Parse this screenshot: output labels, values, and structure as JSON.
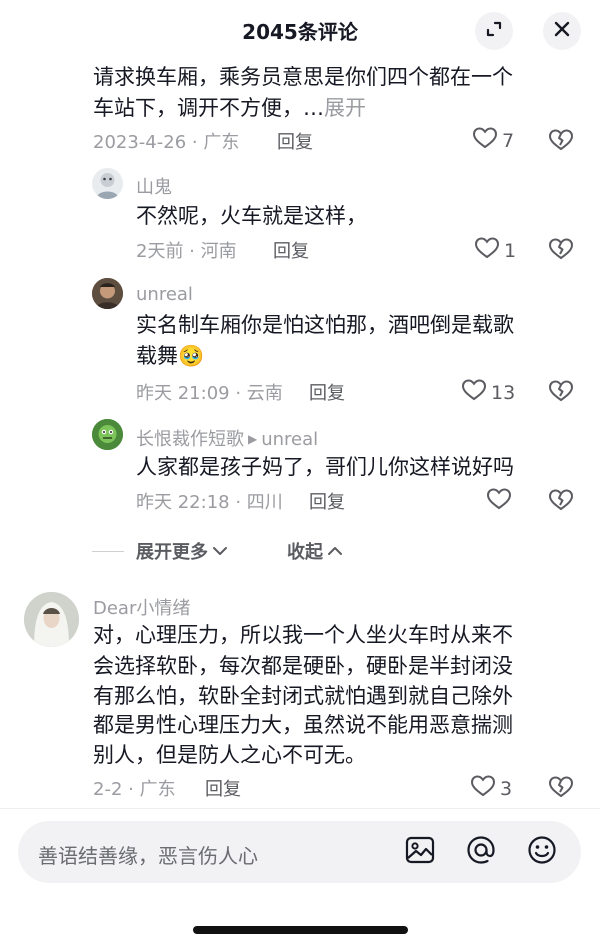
{
  "header": {
    "title": "2045条评论"
  },
  "icons": {
    "expand": "expand-icon",
    "close": "close-icon",
    "heart": "heart-icon",
    "dislike": "broken-heart-icon",
    "image": "image-icon",
    "at": "at-icon",
    "emoji": "emoji-icon"
  },
  "colors": {
    "text": "#161823",
    "muted": "#9b9ca1",
    "reply": "#5b5c61"
  },
  "comments": {
    "top": {
      "line1": "请求换车厢，乘务员意思是你们四个都在一个",
      "line2": "车站下，调开不方便，…",
      "expand_label": "展开",
      "meta": "2023-4-26 · 广东",
      "reply": "回复",
      "likes": "7"
    },
    "r1": {
      "name": "山鬼",
      "text": "不然呢，火车就是这样，",
      "meta": "2天前 · 河南",
      "reply": "回复",
      "likes": "1"
    },
    "r2": {
      "name": "unreal",
      "line1": "实名制车厢你是怕这怕那，酒吧倒是载歌",
      "line2": "载舞",
      "emoji": "🥹",
      "meta": "昨天 21:09 · 云南",
      "reply": "回复",
      "likes": "13"
    },
    "r3": {
      "name": "长恨裁作短歌",
      "reply_to": "unreal",
      "text": "人家都是孩子妈了，哥们儿你这样说好吗",
      "meta": "昨天 22:18 · 四川",
      "reply": "回复"
    },
    "expand_more": "展开更多",
    "collapse": "收起",
    "c2": {
      "name": "Dear小情绪",
      "lines": [
        "对，心理压力，所以我一个人坐火车时从来不",
        "会选择软卧，每次都是硬卧，硬卧是半封闭没",
        "有那么怕，软卧全封闭式就怕遇到就自己除外",
        "都是男性心理压力大，虽然说不能用恶意揣测",
        "别人，但是防人之心不可无。"
      ],
      "meta": "2-2 · 广东",
      "reply": "回复",
      "likes": "3"
    }
  },
  "input": {
    "placeholder": "善语结善缘，恶言伤人心"
  }
}
